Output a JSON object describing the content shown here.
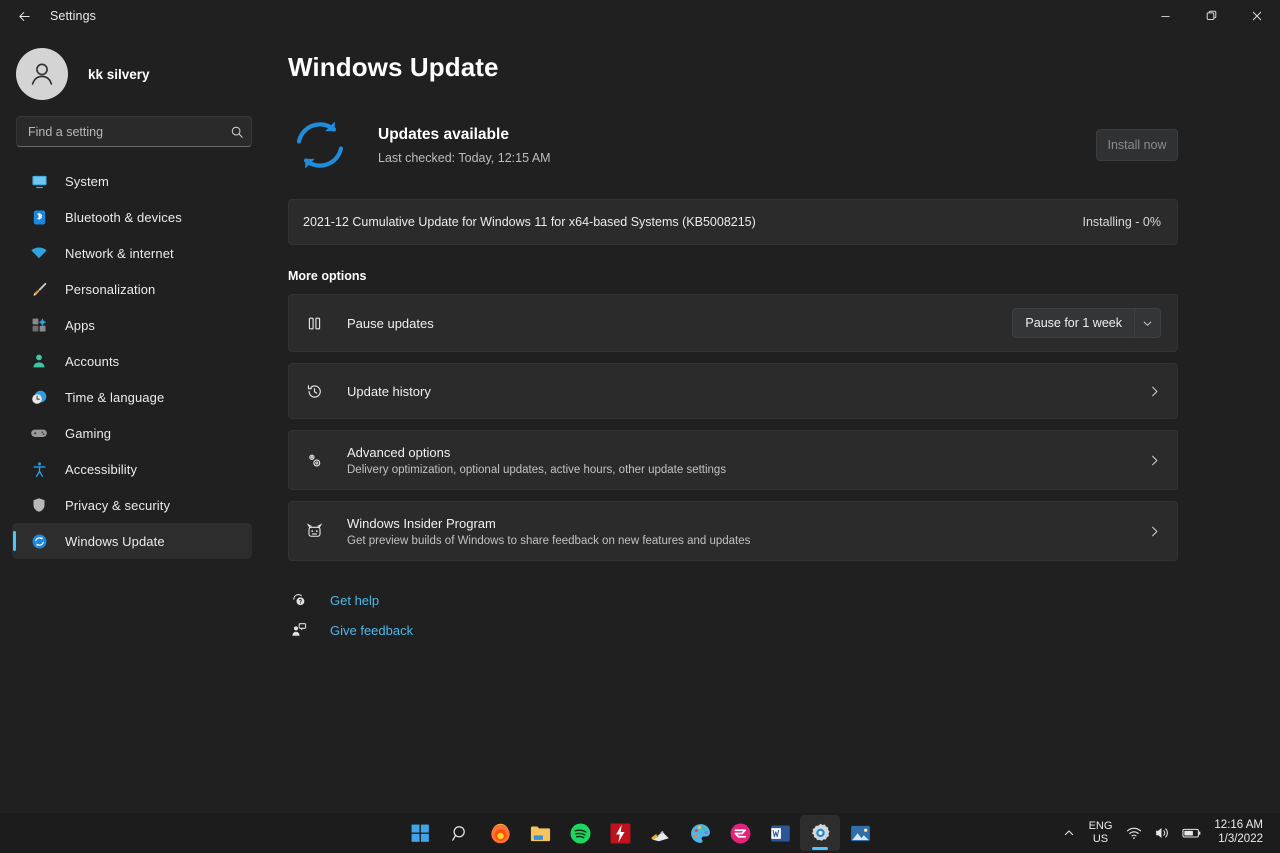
{
  "titlebar": {
    "back_label": "back-arrow",
    "title": "Settings",
    "minimize": "minimize",
    "maximize": "maximize",
    "close": "close"
  },
  "sidebar": {
    "account_name": "kk silvery",
    "search": {
      "placeholder": "Find a setting",
      "value": "",
      "icon": "search-icon"
    },
    "items": [
      {
        "label": "System",
        "icon": "monitor-icon",
        "active": false
      },
      {
        "label": "Bluetooth & devices",
        "icon": "bluetooth-icon",
        "active": false
      },
      {
        "label": "Network & internet",
        "icon": "wifi-icon",
        "active": false
      },
      {
        "label": "Personalization",
        "icon": "paintbrush-icon",
        "active": false
      },
      {
        "label": "Apps",
        "icon": "apps-grid-icon",
        "active": false
      },
      {
        "label": "Accounts",
        "icon": "person-icon",
        "active": false
      },
      {
        "label": "Time & language",
        "icon": "clock-globe-icon",
        "active": false
      },
      {
        "label": "Gaming",
        "icon": "gamepad-icon",
        "active": false
      },
      {
        "label": "Accessibility",
        "icon": "accessibility-icon",
        "active": false
      },
      {
        "label": "Privacy & security",
        "icon": "shield-icon",
        "active": false
      },
      {
        "label": "Windows Update",
        "icon": "update-sync-icon",
        "active": true
      }
    ]
  },
  "main": {
    "page_title": "Windows Update",
    "status": {
      "icon": "sync-circle-icon",
      "title": "Updates available",
      "subtitle": "Last checked: Today, 12:15 AM",
      "install_button": "Install now",
      "install_button_disabled": true
    },
    "update_item": {
      "name": "2021-12 Cumulative Update for Windows 11 for x64-based Systems (KB5008215)",
      "status": "Installing - 0%"
    },
    "more_options_label": "More options",
    "options": [
      {
        "title": "Pause updates",
        "subtitle": "",
        "icon": "pause-icon",
        "control": "dropdown",
        "dropdown_value": "Pause for 1 week"
      },
      {
        "title": "Update history",
        "subtitle": "",
        "icon": "history-icon",
        "control": "chevron"
      },
      {
        "title": "Advanced options",
        "subtitle": "Delivery optimization, optional updates, active hours, other update settings",
        "icon": "gears-icon",
        "control": "chevron"
      },
      {
        "title": "Windows Insider Program",
        "subtitle": "Get preview builds of Windows to share feedback on new features and updates",
        "icon": "insider-bug-icon",
        "control": "chevron"
      }
    ],
    "links": [
      {
        "label": "Get help",
        "icon": "help-icon"
      },
      {
        "label": "Give feedback",
        "icon": "feedback-icon"
      }
    ]
  },
  "taskbar": {
    "items": [
      {
        "name": "start-button",
        "icon": "windows-logo-icon",
        "active": false,
        "running": false
      },
      {
        "name": "search-button",
        "icon": "search-icon",
        "active": false,
        "running": false
      },
      {
        "name": "firefox-button",
        "icon": "firefox-icon",
        "active": false,
        "running": true
      },
      {
        "name": "file-explorer-button",
        "icon": "folder-icon",
        "active": false,
        "running": true
      },
      {
        "name": "spotify-button",
        "icon": "spotify-icon",
        "active": false,
        "running": false
      },
      {
        "name": "flash-app-button",
        "icon": "lightning-icon",
        "active": false,
        "running": false
      },
      {
        "name": "cleaner-button",
        "icon": "broom-icon",
        "active": false,
        "running": false
      },
      {
        "name": "paint-button",
        "icon": "palette-icon",
        "active": false,
        "running": false
      },
      {
        "name": "media-app-button",
        "icon": "pink-circle-icon",
        "active": false,
        "running": true
      },
      {
        "name": "word-button",
        "icon": "word-icon",
        "active": false,
        "running": true
      },
      {
        "name": "settings-button",
        "icon": "gear-icon",
        "active": true,
        "running": true
      },
      {
        "name": "photos-button",
        "icon": "photos-icon",
        "active": false,
        "running": true
      }
    ],
    "tray": {
      "overflow": "chevron-up-icon",
      "language_line1": "ENG",
      "language_line2": "US",
      "wifi": "wifi-icon",
      "volume": "speaker-icon",
      "battery": "battery-icon",
      "time": "12:16 AM",
      "date": "1/3/2022"
    }
  },
  "colors": {
    "accent": "#4cc2ff",
    "page_bg": "#202020",
    "card_bg": "#2b2b2b",
    "link": "#4db8e8"
  }
}
